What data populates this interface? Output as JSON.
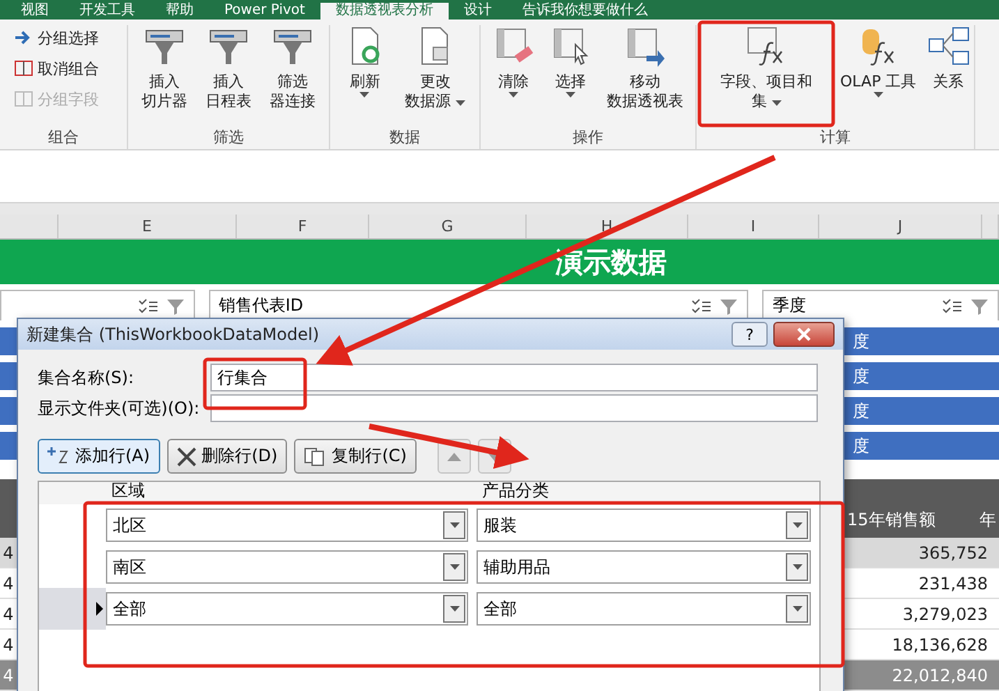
{
  "tabs": [
    {
      "label": "视图",
      "selected": false
    },
    {
      "label": "开发工具",
      "selected": false
    },
    {
      "label": "帮助",
      "selected": false
    },
    {
      "label": "Power Pivot",
      "selected": false
    },
    {
      "label": "数据透视表分析",
      "selected": true
    },
    {
      "label": "设计",
      "selected": false
    },
    {
      "label": "告诉我你想要做什么",
      "selected": false
    }
  ],
  "ribbon": [
    {
      "label": "组合",
      "kind": "small",
      "buttons": [
        {
          "lines": [
            "分组选择"
          ],
          "disabled": false
        },
        {
          "lines": [
            "取消组合"
          ],
          "disabled": false
        },
        {
          "lines": [
            "分组字段"
          ],
          "disabled": true
        }
      ]
    },
    {
      "label": "筛选",
      "kind": "large",
      "buttons": [
        {
          "lines": [
            "插入",
            "切片器"
          ],
          "dropdown": false
        },
        {
          "lines": [
            "插入",
            "日程表"
          ],
          "dropdown": false
        },
        {
          "lines": [
            "筛选",
            "器连接"
          ],
          "dropdown": false
        }
      ]
    },
    {
      "label": "数据",
      "kind": "large",
      "buttons": [
        {
          "lines": [
            "刷新"
          ],
          "dropdown": true
        },
        {
          "lines": [
            "更改",
            "数据源"
          ],
          "dropdown": true
        }
      ]
    },
    {
      "label": "操作",
      "kind": "large",
      "buttons": [
        {
          "lines": [
            "清除"
          ],
          "dropdown": true
        },
        {
          "lines": [
            "选择"
          ],
          "dropdown": true
        },
        {
          "lines": [
            "移动",
            "数据透视表"
          ],
          "dropdown": false
        }
      ]
    },
    {
      "label": "计算",
      "kind": "large",
      "buttons": [
        {
          "lines": [
            "字段、项目和",
            "集"
          ],
          "dropdown": true
        },
        {
          "lines": [
            "OLAP 工具"
          ],
          "dropdown": true
        },
        {
          "lines": [
            "关系"
          ],
          "dropdown": false
        }
      ]
    }
  ],
  "sheet": {
    "columns": [
      "E",
      "F",
      "G",
      "H",
      "I",
      "J"
    ],
    "banner": "演示数据"
  },
  "slicers": [
    {
      "title": "销售代表ID"
    },
    {
      "title": "季度",
      "items": [
        "度",
        "度",
        "度",
        "度"
      ]
    }
  ],
  "table": {
    "columns": [
      "15年销售额",
      "年"
    ],
    "rows": [
      {
        "column_1": "4",
        "value": "365,752",
        "kind": "band"
      },
      {
        "column_1": "4",
        "value": "231,438",
        "kind": "plain"
      },
      {
        "column_1": "4",
        "value": "3,279,023",
        "kind": "plain"
      },
      {
        "column_1": "4",
        "value": "18,136,628",
        "kind": "plain"
      },
      {
        "column_1": "4",
        "value": "22,012,840",
        "kind": "total"
      }
    ]
  },
  "dialog": {
    "title": "新建集合 (ThisWorkbookDataModel)",
    "help": "?",
    "fields": [
      {
        "label": "集合名称(S):",
        "value": "行集合"
      },
      {
        "label": "显示文件夹(可选)(O):"
      }
    ],
    "buttons": [
      {
        "label": "添加行(A)",
        "focused": true
      },
      {
        "label": "删除行(D)",
        "focused": false
      },
      {
        "label": "复制行(C)",
        "focused": false
      }
    ],
    "move_up": {
      "disabled": true
    },
    "move_down": {
      "disabled": true
    },
    "grid": {
      "columns": [
        "区域",
        "产品分类"
      ],
      "rows": [
        {
          "cells": [
            "北区",
            "服装"
          ],
          "current": false
        },
        {
          "cells": [
            "南区",
            "辅助用品"
          ],
          "current": false
        },
        {
          "cells": [
            "全部",
            "全部"
          ],
          "current": true
        }
      ]
    }
  }
}
